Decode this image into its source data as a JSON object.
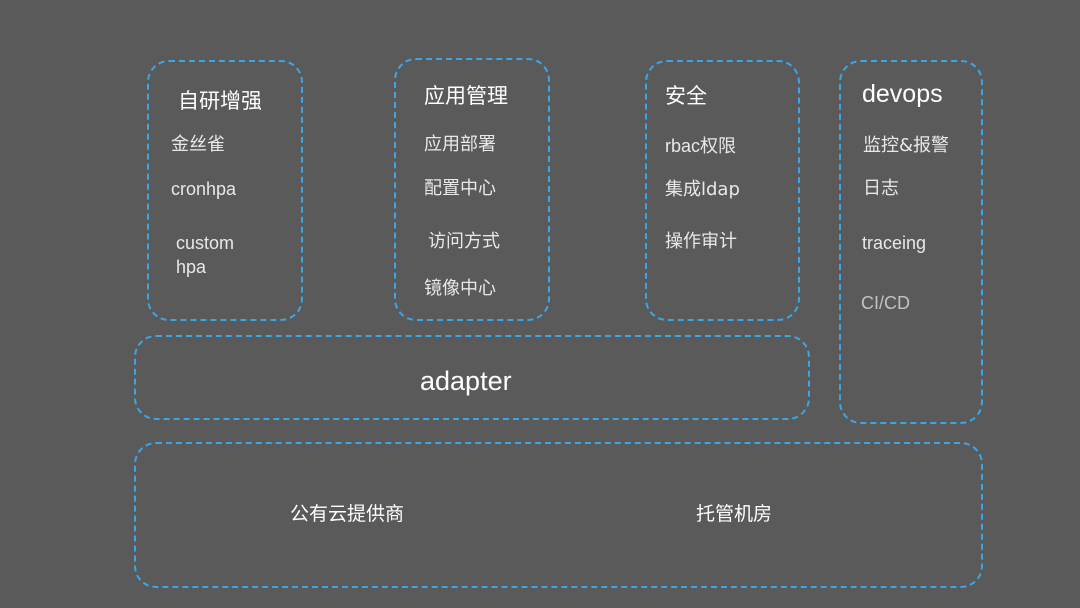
{
  "modules": [
    {
      "title": "自研增强",
      "items": [
        "金丝雀",
        "cronhpa",
        "custom",
        "hpa"
      ]
    },
    {
      "title": "应用管理",
      "items": [
        "应用部署",
        "配置中心",
        "访问方式",
        "镜像中心"
      ]
    },
    {
      "title": "安全",
      "items": [
        "rbac权限",
        "集成ldap",
        "操作审计"
      ]
    },
    {
      "title": "devops",
      "items": [
        "监控&报警",
        "日志",
        "traceing",
        "CI/CD"
      ]
    }
  ],
  "adapter": {
    "label": "adapter"
  },
  "infrastructure": {
    "items": [
      "公有云提供商",
      "托管机房"
    ]
  },
  "colors": {
    "background": "#5a5a5a",
    "border": "#3aa6e6",
    "text": "#ffffff"
  }
}
